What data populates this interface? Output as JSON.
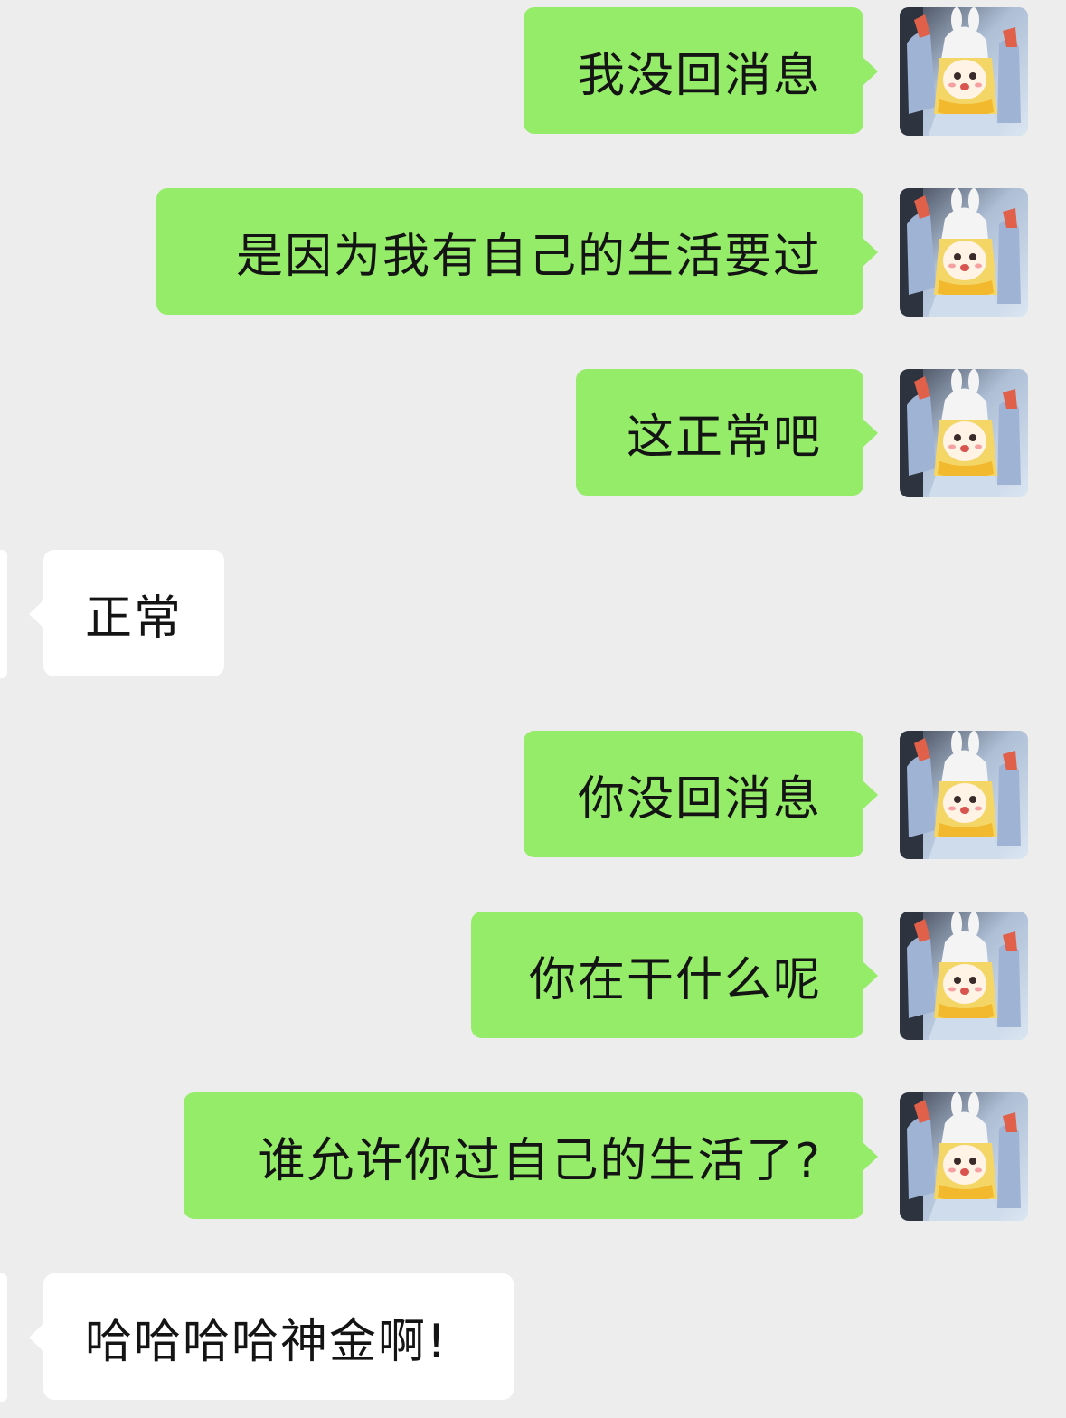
{
  "messages": [
    {
      "side": "out",
      "text": "我没回消息"
    },
    {
      "side": "out",
      "text": "是因为我有自己的生活要过"
    },
    {
      "side": "out",
      "text": "这正常吧"
    },
    {
      "side": "in",
      "text": "正常"
    },
    {
      "side": "out",
      "text": "你没回消息"
    },
    {
      "side": "out",
      "text": "你在干什么呢"
    },
    {
      "side": "out",
      "text": "谁允许你过自己的生活了?"
    },
    {
      "side": "in",
      "text": "哈哈哈哈神金啊!"
    }
  ],
  "avatar": {
    "icon": "anime-girl-bunny-hat-avatar-icon"
  },
  "colors": {
    "background": "#ededed",
    "outgoing_bubble": "#95ec69",
    "incoming_bubble": "#ffffff",
    "text": "#141414"
  }
}
